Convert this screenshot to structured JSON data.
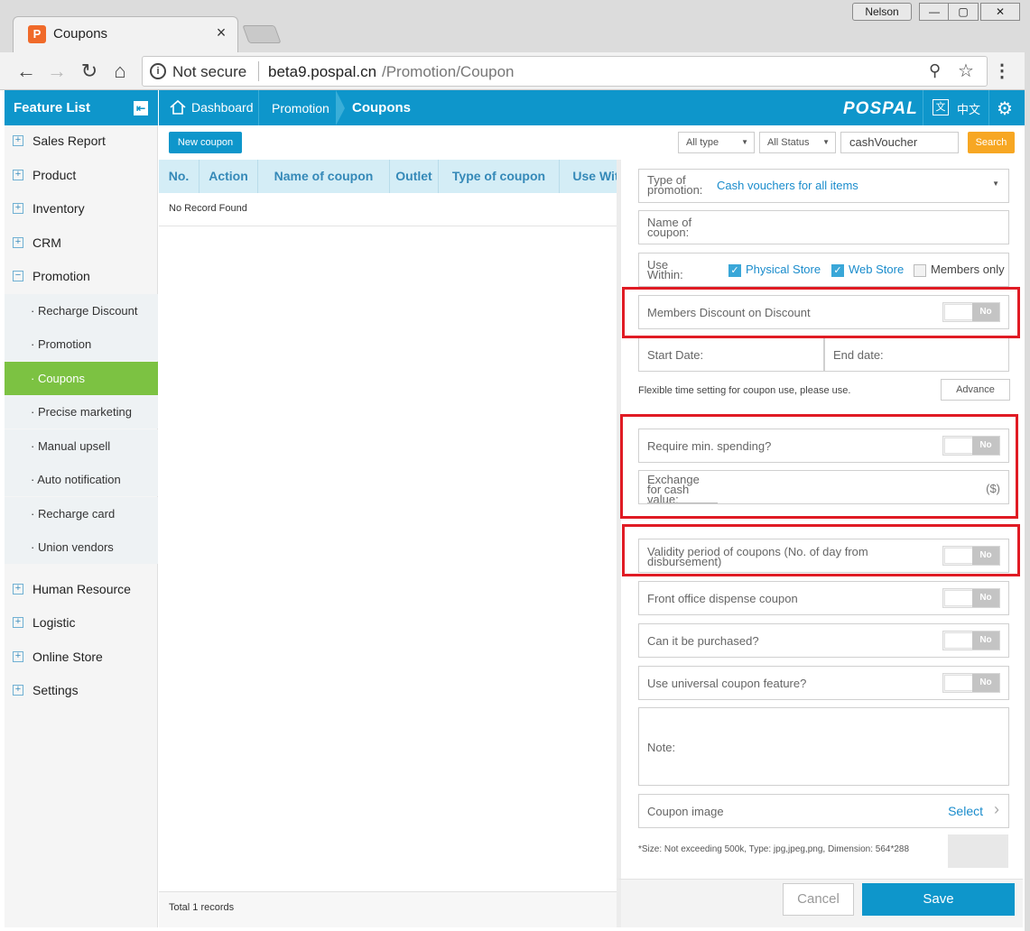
{
  "browser": {
    "tab_title": "Coupons",
    "tab_close": "×",
    "user": "Nelson",
    "security_label": "Not secure",
    "url_host": "beta9.pospal.cn",
    "url_path": "/Promotion/Coupon"
  },
  "sidebar": {
    "title": "Feature List",
    "items": [
      {
        "label": "Sales Report"
      },
      {
        "label": "Product"
      },
      {
        "label": "Inventory"
      },
      {
        "label": "CRM"
      },
      {
        "label": "Promotion"
      }
    ],
    "promotion_sub": [
      {
        "label": "· Recharge Discount"
      },
      {
        "label": "· Promotion"
      },
      {
        "label": "· Coupons"
      },
      {
        "label": "· Precise marketing"
      },
      {
        "label": "· Manual upsell"
      },
      {
        "label": "· Auto notification"
      },
      {
        "label": "· Recharge card"
      },
      {
        "label": "· Union vendors"
      }
    ],
    "items_after": [
      {
        "label": "Human Resource"
      },
      {
        "label": "Logistic"
      },
      {
        "label": "Online Store"
      },
      {
        "label": "Settings"
      }
    ]
  },
  "topbar": {
    "dashboard": "Dashboard",
    "promotion": "Promotion",
    "coupons": "Coupons",
    "logo": "POSPAL",
    "lang": "中文"
  },
  "toolbar": {
    "new_coupon": "New coupon",
    "type_filter": "All type",
    "status_filter": "All Status",
    "search_value": "cashVoucher",
    "search_button": "Search"
  },
  "table": {
    "columns": [
      "No.",
      "Action",
      "Name of coupon",
      "Outlet",
      "Type of coupon",
      "Use Wit"
    ],
    "empty_text": "No Record Found",
    "total": "Total 1 records"
  },
  "form": {
    "type_label": "Type of promotion:",
    "type_value": "Cash vouchers for all items",
    "name_label": "Name of coupon:",
    "use_within_label": "Use Within:",
    "physical_store": "Physical Store",
    "web_store": "Web Store",
    "members_only": "Members only",
    "members_discount": "Members Discount on Discount",
    "start_date": "Start Date:",
    "end_date": "End date:",
    "flexible_note": "Flexible time setting for coupon use, please use.",
    "advance_button": "Advance",
    "min_spending": "Require min. spending?",
    "exchange_label": "Exchange for cash value:",
    "currency": "($)",
    "validity": "Validity period of coupons (No. of day from disbursement)",
    "front_office": "Front office dispense coupon",
    "purchased": "Can it be purchased?",
    "universal": "Use universal coupon feature?",
    "note_label": "Note:",
    "coupon_image": "Coupon image",
    "select": "Select",
    "size_note": "*Size: Not exceeding 500k, Type: jpg,jpeg,png, Dimension: 564*288",
    "toggle_no": "No",
    "cancel": "Cancel",
    "save": "Save"
  },
  "colors": {
    "accent": "#0e96cb",
    "active_menu": "#7cc242",
    "search_button": "#f7a723",
    "highlight_box": "#e01b24"
  }
}
